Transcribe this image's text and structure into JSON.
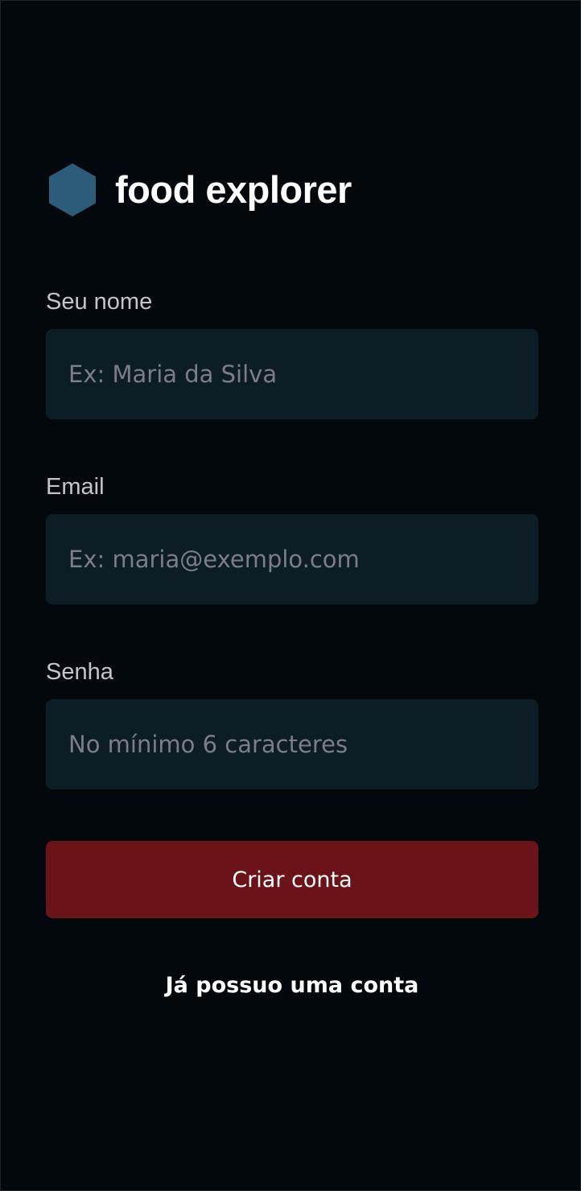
{
  "brand": {
    "name": "food explorer",
    "icon": "hexagon-logo-icon",
    "icon_color": "#2d5c7a"
  },
  "form": {
    "name_field": {
      "label": "Seu nome",
      "placeholder": "Ex: Maria da Silva",
      "value": ""
    },
    "email_field": {
      "label": "Email",
      "placeholder": "Ex: maria@exemplo.com",
      "value": ""
    },
    "password_field": {
      "label": "Senha",
      "placeholder": "No mínimo 6 caracteres",
      "value": ""
    },
    "submit_label": "Criar conta",
    "login_link": "Já possuo uma conta"
  },
  "colors": {
    "background": "#02080c",
    "input_background": "#0d1d25",
    "button": "#6b1318",
    "label": "#c4c4cc",
    "placeholder": "#7c7c8a"
  }
}
